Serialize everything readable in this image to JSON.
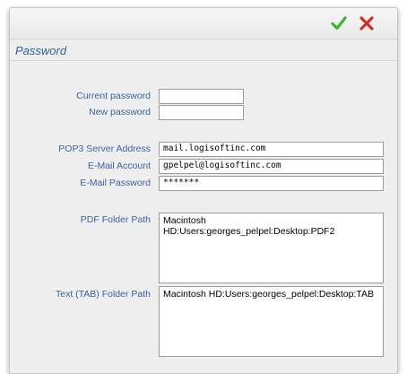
{
  "toolbar": {
    "confirm_icon": "checkmark-icon",
    "cancel_icon": "cross-icon",
    "confirm_color": "#3cb52e",
    "cancel_color": "#d12f2f"
  },
  "section": {
    "title": "Password"
  },
  "fields": {
    "current_password": {
      "label": "Current password",
      "value": ""
    },
    "new_password": {
      "label": "New password",
      "value": ""
    },
    "pop3_server": {
      "label": "POP3 Server Address",
      "value": "mail.logisoftinc.com"
    },
    "email_account": {
      "label": "E-Mail  Account",
      "value": "gpelpel@logisoftinc.com"
    },
    "email_password": {
      "label": "E-Mail Password",
      "value": "*******"
    },
    "pdf_folder": {
      "label": "PDF Folder Path",
      "value": "Macintosh HD:Users:georges_pelpel:Desktop:PDF2"
    },
    "text_folder": {
      "label": "Text (TAB) Folder Path",
      "value": "Macintosh HD:Users:georges_pelpel:Desktop:TAB"
    }
  }
}
